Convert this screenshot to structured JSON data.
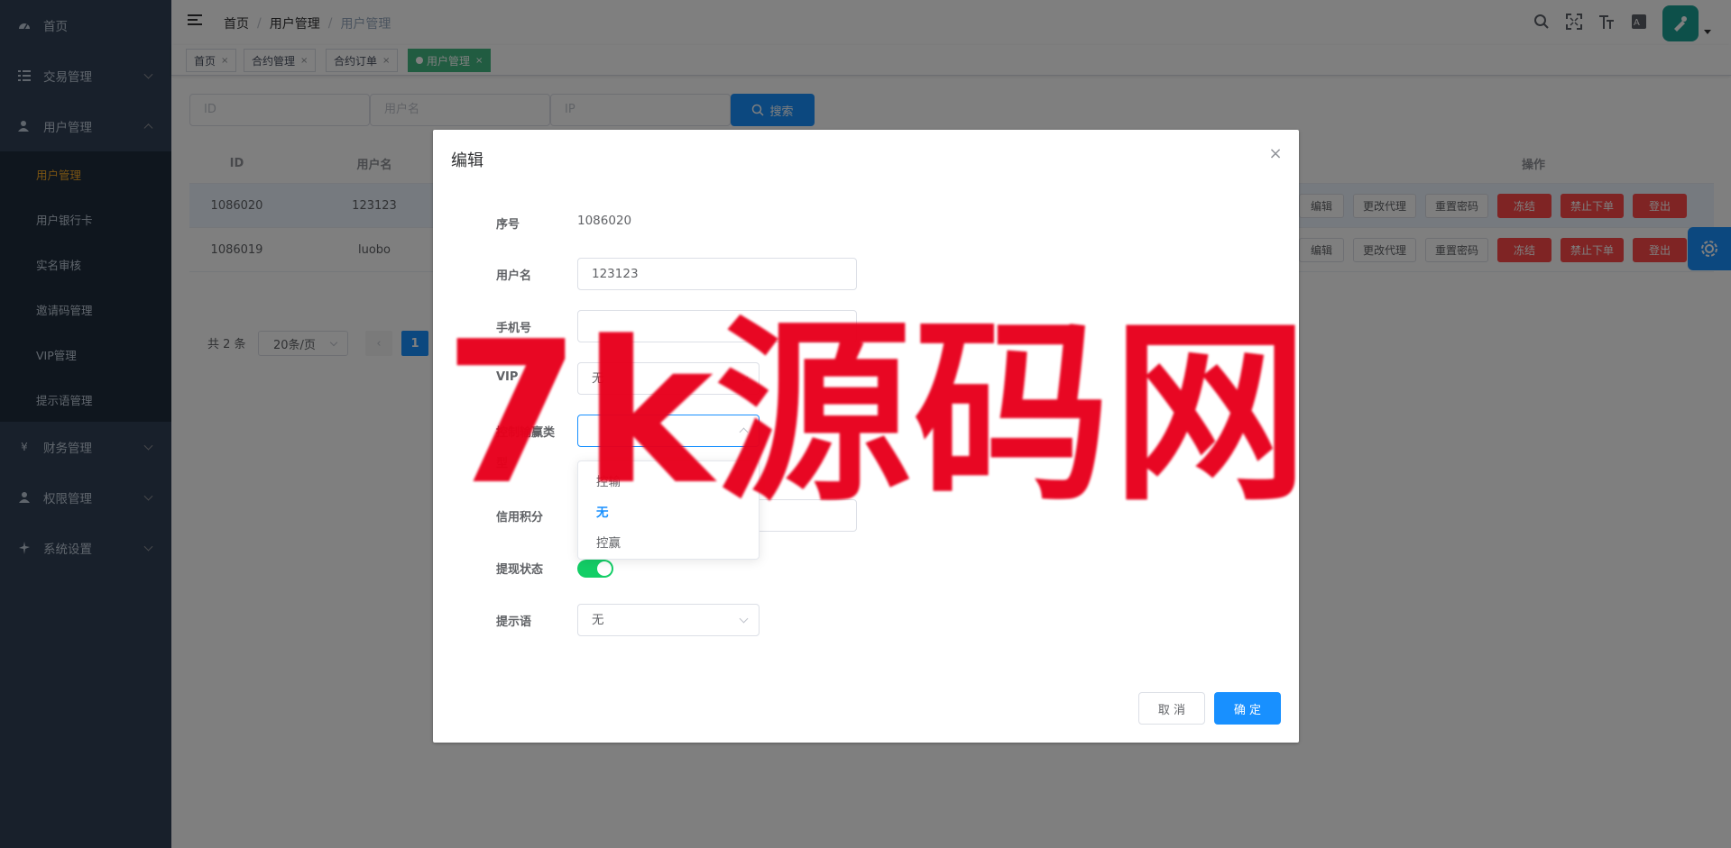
{
  "sidebar": {
    "items": [
      {
        "label": "首页",
        "icon": "dashboard-icon"
      },
      {
        "label": "交易管理",
        "icon": "list-icon"
      },
      {
        "label": "用户管理",
        "icon": "user-icon"
      },
      {
        "label": "财务管理",
        "icon": "yen-icon"
      },
      {
        "label": "权限管理",
        "icon": "person-icon"
      },
      {
        "label": "系统设置",
        "icon": "settings-icon"
      }
    ],
    "user_submenu": [
      "用户管理",
      "用户银行卡",
      "实名审核",
      "邀请码管理",
      "VIP管理",
      "提示语管理"
    ]
  },
  "header": {
    "breadcrumb": [
      "首页",
      "用户管理",
      "用户管理"
    ],
    "icons": [
      "search-icon",
      "fullscreen-icon",
      "font-size-icon",
      "language-icon"
    ]
  },
  "tags": [
    {
      "label": "首页",
      "close": "×"
    },
    {
      "label": "合约管理",
      "close": "×"
    },
    {
      "label": "合约订单",
      "close": "×"
    },
    {
      "label": "用户管理",
      "close": "×",
      "active": true
    }
  ],
  "filter": {
    "id_placeholder": "ID",
    "username_placeholder": "用户名",
    "ip_placeholder": "IP",
    "search_label": "搜索"
  },
  "table": {
    "headers": {
      "id": "ID",
      "username": "用户名",
      "actions": "操作"
    },
    "rows": [
      {
        "id": "1086020",
        "username": "123123"
      },
      {
        "id": "1086019",
        "username": "luobo"
      }
    ],
    "row_actions": {
      "edit": "编辑",
      "change_agent": "更改代理",
      "reset_password": "重置密码",
      "freeze": "冻结",
      "ban_order": "禁止下单",
      "logout": "登出"
    }
  },
  "pagination": {
    "total": "共 2 条",
    "page_size": "20条/页",
    "prev": "‹",
    "current": "1"
  },
  "dialog": {
    "title": "编辑",
    "close": "×",
    "fields": {
      "seq_label": "序号",
      "seq_value": "1086020",
      "username_label": "用户名",
      "username_value": "123123",
      "phone_label": "手机号",
      "phone_value": "",
      "vip_label": "VIP",
      "vip_value": "无",
      "control_label_1": "控制输赢类",
      "control_label_2": "型",
      "credit_label": "信用积分",
      "withdraw_label": "提现状态",
      "tip_label": "提示语",
      "tip_value": "无"
    },
    "withdraw_enabled": true,
    "dropdown_options": [
      {
        "label": "控输",
        "selected": false
      },
      {
        "label": "无",
        "selected": true
      },
      {
        "label": "控赢",
        "selected": false
      }
    ],
    "cancel_label": "取 消",
    "ok_label": "确 定"
  },
  "watermark": "7k源码网",
  "colors": {
    "sidebar_bg": "#304156",
    "sidebar_active": "#f4a827",
    "primary": "#1890ff",
    "danger": "#ff4949",
    "tag_active": "#42b983",
    "switch_on": "#13ce66",
    "watermark": "#e8001c"
  }
}
